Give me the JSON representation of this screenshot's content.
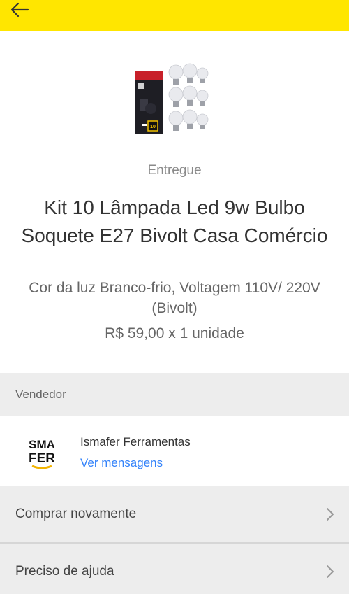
{
  "header": {
    "back_icon": "arrow-left-icon"
  },
  "product": {
    "status": "Entregue",
    "title": "Kit 10 Lâmpada Led 9w Bulbo Soquete E27 Bivolt Casa Comércio",
    "variant": "Cor da luz Branco-frio, Voltagem 110V/ 220V (Bivolt)",
    "price_line": "R$ 59,00 x 1 unidade",
    "image_text": "10"
  },
  "seller": {
    "section_label": "Vendedor",
    "name": "Ismafer Ferramentas",
    "link_label": "Ver mensagens",
    "logo_text_top": "SMA",
    "logo_text_bottom": "FER"
  },
  "actions": [
    {
      "label": "Comprar novamente",
      "icon": "chevron-right-icon"
    },
    {
      "label": "Preciso de ajuda",
      "icon": "chevron-right-icon"
    }
  ],
  "colors": {
    "brand_yellow": "#ffe600",
    "link_blue": "#3483fa",
    "section_gray": "#ededed"
  }
}
